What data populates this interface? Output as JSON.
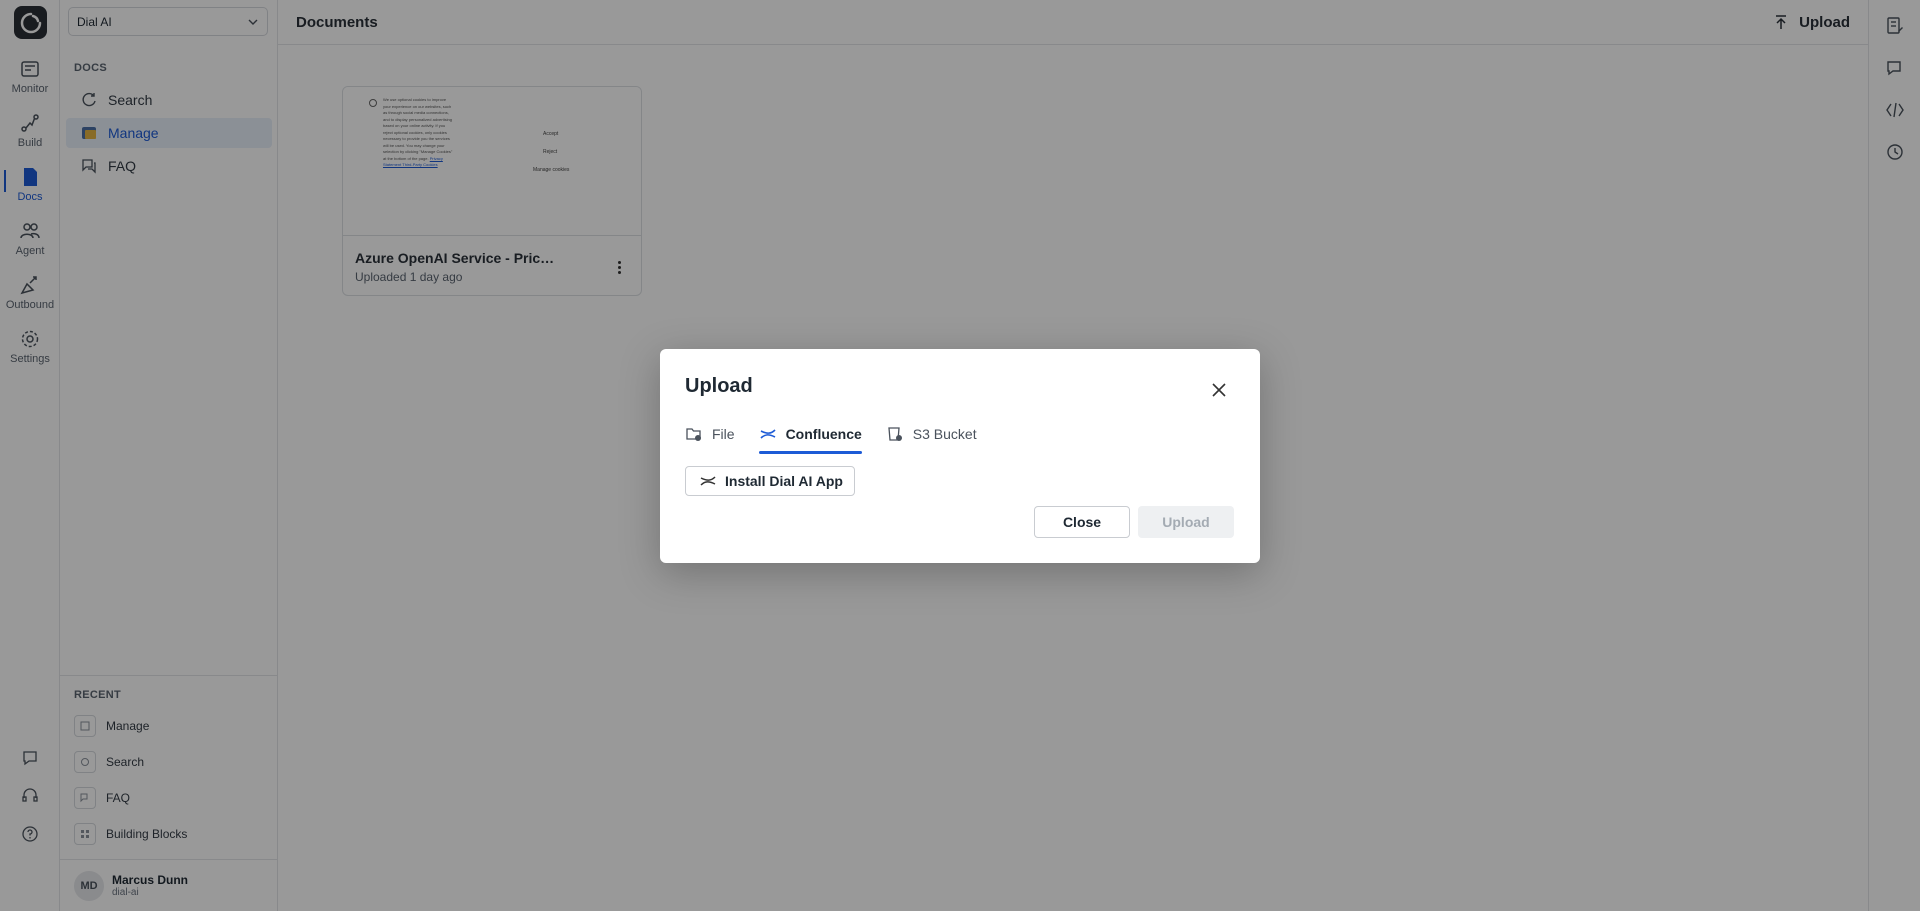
{
  "rail": {
    "items": [
      {
        "label": "Monitor",
        "icon": "monitor-icon"
      },
      {
        "label": "Build",
        "icon": "build-icon"
      },
      {
        "label": "Docs",
        "icon": "docs-icon",
        "active": true
      },
      {
        "label": "Agent",
        "icon": "agent-icon"
      },
      {
        "label": "Outbound",
        "icon": "outbound-icon"
      },
      {
        "label": "Settings",
        "icon": "settings-icon"
      }
    ],
    "bottom_icons": [
      "chat-icon",
      "headset-icon",
      "help-icon"
    ]
  },
  "sidebar": {
    "org_select": "Dial AI",
    "section_title": "DOCS",
    "items": [
      {
        "label": "Search",
        "icon": "search-icon"
      },
      {
        "label": "Manage",
        "icon": "manage-icon",
        "active": true
      },
      {
        "label": "FAQ",
        "icon": "faq-icon"
      }
    ],
    "recent_title": "RECENT",
    "recent": [
      {
        "label": "Manage"
      },
      {
        "label": "Search"
      },
      {
        "label": "FAQ"
      },
      {
        "label": "Building Blocks"
      }
    ],
    "user": {
      "initials": "MD",
      "name": "Marcus Dunn",
      "org": "dial-ai"
    }
  },
  "main": {
    "title": "Documents",
    "upload_label": "Upload",
    "document": {
      "title": "Azure OpenAI Service - Pric…",
      "subtitle": "Uploaded 1 day ago",
      "thumb_text": "We use optional cookies to improve your experience on our websites, such as through social media connections, and to display personalized advertising based on your online activity. If you reject optional cookies, only cookies necessary to provide you the services will be used. You may change your selection by clicking \"Manage Cookies\" at the bottom of the page.",
      "thumb_link": "Privacy Statement Third-Party Cookies",
      "thumb_buttons": [
        "Accept",
        "Reject",
        "Manage cookies"
      ]
    }
  },
  "right_rail": {
    "icons": [
      "notes-icon",
      "chat-bubble-icon",
      "code-icon",
      "history-icon"
    ]
  },
  "modal": {
    "title": "Upload",
    "tabs": [
      {
        "label": "File",
        "icon": "file-folder-icon"
      },
      {
        "label": "Confluence",
        "icon": "confluence-icon",
        "active": true
      },
      {
        "label": "S3 Bucket",
        "icon": "s3-bucket-icon"
      }
    ],
    "install_label": "Install Dial AI App",
    "close_label": "Close",
    "upload_label": "Upload"
  },
  "colors": {
    "accent": "#1d5bd6",
    "overlay": "rgba(0,0,0,0.40)"
  }
}
